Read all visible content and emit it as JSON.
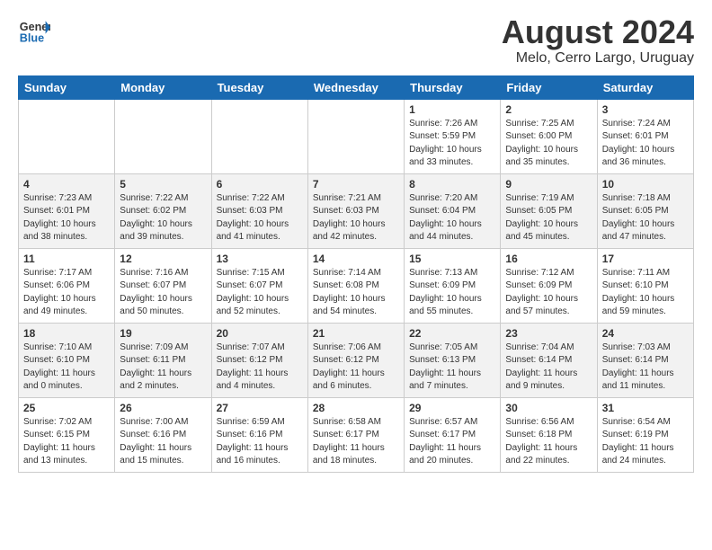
{
  "header": {
    "logo_line1": "General",
    "logo_line2": "Blue",
    "main_title": "August 2024",
    "subtitle": "Melo, Cerro Largo, Uruguay"
  },
  "days_of_week": [
    "Sunday",
    "Monday",
    "Tuesday",
    "Wednesday",
    "Thursday",
    "Friday",
    "Saturday"
  ],
  "weeks": [
    [
      {
        "day": "",
        "info": ""
      },
      {
        "day": "",
        "info": ""
      },
      {
        "day": "",
        "info": ""
      },
      {
        "day": "",
        "info": ""
      },
      {
        "day": "1",
        "info": "Sunrise: 7:26 AM\nSunset: 5:59 PM\nDaylight: 10 hours\nand 33 minutes."
      },
      {
        "day": "2",
        "info": "Sunrise: 7:25 AM\nSunset: 6:00 PM\nDaylight: 10 hours\nand 35 minutes."
      },
      {
        "day": "3",
        "info": "Sunrise: 7:24 AM\nSunset: 6:01 PM\nDaylight: 10 hours\nand 36 minutes."
      }
    ],
    [
      {
        "day": "4",
        "info": "Sunrise: 7:23 AM\nSunset: 6:01 PM\nDaylight: 10 hours\nand 38 minutes."
      },
      {
        "day": "5",
        "info": "Sunrise: 7:22 AM\nSunset: 6:02 PM\nDaylight: 10 hours\nand 39 minutes."
      },
      {
        "day": "6",
        "info": "Sunrise: 7:22 AM\nSunset: 6:03 PM\nDaylight: 10 hours\nand 41 minutes."
      },
      {
        "day": "7",
        "info": "Sunrise: 7:21 AM\nSunset: 6:03 PM\nDaylight: 10 hours\nand 42 minutes."
      },
      {
        "day": "8",
        "info": "Sunrise: 7:20 AM\nSunset: 6:04 PM\nDaylight: 10 hours\nand 44 minutes."
      },
      {
        "day": "9",
        "info": "Sunrise: 7:19 AM\nSunset: 6:05 PM\nDaylight: 10 hours\nand 45 minutes."
      },
      {
        "day": "10",
        "info": "Sunrise: 7:18 AM\nSunset: 6:05 PM\nDaylight: 10 hours\nand 47 minutes."
      }
    ],
    [
      {
        "day": "11",
        "info": "Sunrise: 7:17 AM\nSunset: 6:06 PM\nDaylight: 10 hours\nand 49 minutes."
      },
      {
        "day": "12",
        "info": "Sunrise: 7:16 AM\nSunset: 6:07 PM\nDaylight: 10 hours\nand 50 minutes."
      },
      {
        "day": "13",
        "info": "Sunrise: 7:15 AM\nSunset: 6:07 PM\nDaylight: 10 hours\nand 52 minutes."
      },
      {
        "day": "14",
        "info": "Sunrise: 7:14 AM\nSunset: 6:08 PM\nDaylight: 10 hours\nand 54 minutes."
      },
      {
        "day": "15",
        "info": "Sunrise: 7:13 AM\nSunset: 6:09 PM\nDaylight: 10 hours\nand 55 minutes."
      },
      {
        "day": "16",
        "info": "Sunrise: 7:12 AM\nSunset: 6:09 PM\nDaylight: 10 hours\nand 57 minutes."
      },
      {
        "day": "17",
        "info": "Sunrise: 7:11 AM\nSunset: 6:10 PM\nDaylight: 10 hours\nand 59 minutes."
      }
    ],
    [
      {
        "day": "18",
        "info": "Sunrise: 7:10 AM\nSunset: 6:10 PM\nDaylight: 11 hours\nand 0 minutes."
      },
      {
        "day": "19",
        "info": "Sunrise: 7:09 AM\nSunset: 6:11 PM\nDaylight: 11 hours\nand 2 minutes."
      },
      {
        "day": "20",
        "info": "Sunrise: 7:07 AM\nSunset: 6:12 PM\nDaylight: 11 hours\nand 4 minutes."
      },
      {
        "day": "21",
        "info": "Sunrise: 7:06 AM\nSunset: 6:12 PM\nDaylight: 11 hours\nand 6 minutes."
      },
      {
        "day": "22",
        "info": "Sunrise: 7:05 AM\nSunset: 6:13 PM\nDaylight: 11 hours\nand 7 minutes."
      },
      {
        "day": "23",
        "info": "Sunrise: 7:04 AM\nSunset: 6:14 PM\nDaylight: 11 hours\nand 9 minutes."
      },
      {
        "day": "24",
        "info": "Sunrise: 7:03 AM\nSunset: 6:14 PM\nDaylight: 11 hours\nand 11 minutes."
      }
    ],
    [
      {
        "day": "25",
        "info": "Sunrise: 7:02 AM\nSunset: 6:15 PM\nDaylight: 11 hours\nand 13 minutes."
      },
      {
        "day": "26",
        "info": "Sunrise: 7:00 AM\nSunset: 6:16 PM\nDaylight: 11 hours\nand 15 minutes."
      },
      {
        "day": "27",
        "info": "Sunrise: 6:59 AM\nSunset: 6:16 PM\nDaylight: 11 hours\nand 16 minutes."
      },
      {
        "day": "28",
        "info": "Sunrise: 6:58 AM\nSunset: 6:17 PM\nDaylight: 11 hours\nand 18 minutes."
      },
      {
        "day": "29",
        "info": "Sunrise: 6:57 AM\nSunset: 6:17 PM\nDaylight: 11 hours\nand 20 minutes."
      },
      {
        "day": "30",
        "info": "Sunrise: 6:56 AM\nSunset: 6:18 PM\nDaylight: 11 hours\nand 22 minutes."
      },
      {
        "day": "31",
        "info": "Sunrise: 6:54 AM\nSunset: 6:19 PM\nDaylight: 11 hours\nand 24 minutes."
      }
    ]
  ]
}
